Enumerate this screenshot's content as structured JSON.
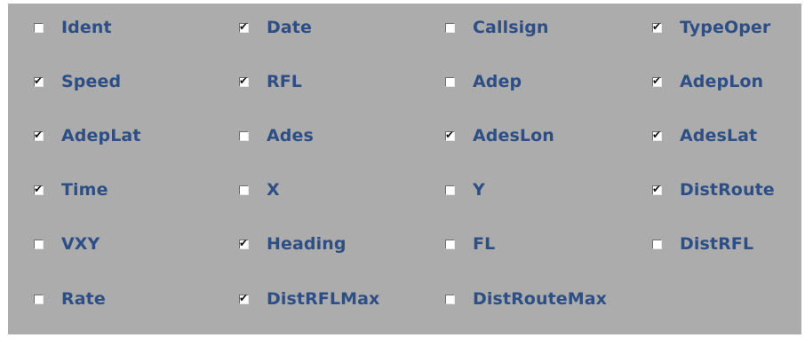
{
  "checkboxes": [
    {
      "label": "Ident",
      "checked": false
    },
    {
      "label": "Date",
      "checked": true
    },
    {
      "label": "Callsign",
      "checked": false
    },
    {
      "label": "TypeOper",
      "checked": true
    },
    {
      "label": "Speed",
      "checked": true
    },
    {
      "label": "RFL",
      "checked": true
    },
    {
      "label": "Adep",
      "checked": false
    },
    {
      "label": "AdepLon",
      "checked": true
    },
    {
      "label": "AdepLat",
      "checked": true
    },
    {
      "label": "Ades",
      "checked": false
    },
    {
      "label": "AdesLon",
      "checked": true
    },
    {
      "label": "AdesLat",
      "checked": true
    },
    {
      "label": "Time",
      "checked": true
    },
    {
      "label": "X",
      "checked": false
    },
    {
      "label": "Y",
      "checked": false
    },
    {
      "label": "DistRoute",
      "checked": true
    },
    {
      "label": "VXY",
      "checked": false
    },
    {
      "label": "Heading",
      "checked": true
    },
    {
      "label": "FL",
      "checked": false
    },
    {
      "label": "DistRFL",
      "checked": false
    },
    {
      "label": "Rate",
      "checked": false
    },
    {
      "label": "DistRFLMax",
      "checked": true
    },
    {
      "label": "DistRouteMax",
      "checked": false
    }
  ],
  "colors": {
    "panel_background": "#acacac",
    "label_text": "#2d4f86"
  }
}
